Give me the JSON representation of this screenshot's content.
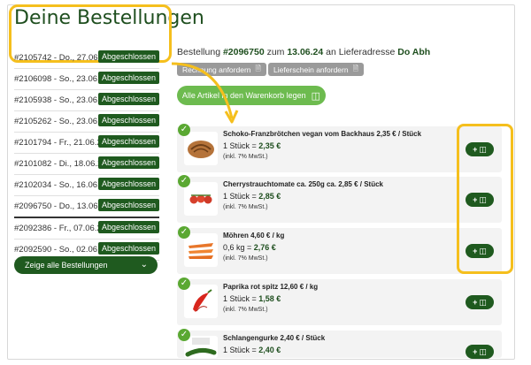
{
  "title": "Deine Bestellungen",
  "orders": [
    {
      "label": "#2105742 - Do., 27.06.24",
      "status": "Abgeschlossen"
    },
    {
      "label": "#2106098 - So., 23.06.24",
      "status": "Abgeschlossen"
    },
    {
      "label": "#2105938 - So., 23.06.24",
      "status": "Abgeschlossen"
    },
    {
      "label": "#2105262 - So., 23.06.24",
      "status": "Abgeschlossen"
    },
    {
      "label": "#2101794 - Fr., 21.06.24",
      "status": "Abgeschlossen"
    },
    {
      "label": "#2101082 - Di., 18.06.24",
      "status": "Abgeschlossen"
    },
    {
      "label": "#2102034 - So., 16.06.24",
      "status": "Abgeschlossen"
    },
    {
      "label": "#2096750 - Do., 13.06.24",
      "status": "Abgeschlossen"
    },
    {
      "label": "#2092386 - Fr., 07.06.24",
      "status": "Abgeschlossen"
    },
    {
      "label": "#2092590 - So., 02.06.24",
      "status": "Abgeschlossen"
    }
  ],
  "show_all": "Zeige alle Bestellungen",
  "detail": {
    "prefix": "Bestellung ",
    "order_no": "#2096750",
    "middle": " zum ",
    "date": "13.06.24",
    "suffix": " an Lieferadresse ",
    "address": "Do Abh",
    "invoice_btn": "Rechnung anfordern",
    "delivery_btn": "Lieferschein anfordern",
    "cart_all": "Alle Artikel in den Warenkorb legen"
  },
  "items": [
    {
      "name": "Schoko-Franzbrötchen vegan vom Backhaus 2,35 € / Stück",
      "qty": "1 Stück = ",
      "price": "2,35 €",
      "tax": "(inkl. 7% MwSt.)"
    },
    {
      "name": "Cherrystrauchtomate ca. 250g ca. 2,85 € / Stück",
      "qty": "1 Stück = ",
      "price": "2,85 €",
      "tax": "(inkl. 7% MwSt.)"
    },
    {
      "name": "Möhren 4,60 € / kg",
      "qty": "0,6 kg = ",
      "price": "2,76 €",
      "tax": "(inkl. 7% MwSt.)"
    },
    {
      "name": "Paprika rot spitz 12,60 € / kg",
      "qty": "1 Stück = ",
      "price": "1,58 €",
      "tax": "(inkl. 7% MwSt.)"
    },
    {
      "name": "Schlangengurke 2,40 € / Stück",
      "qty": "1 Stück = ",
      "price": "2,40 €",
      "tax": ""
    }
  ],
  "icons": {
    "check": "check-icon",
    "cart": "cart-box-icon",
    "document": "document-icon",
    "chevron": "chevron-down-icon"
  },
  "colors": {
    "brand_dark_green": "#1f5a1f",
    "accent_green": "#6dbb4f",
    "highlight": "#f5bf1d"
  }
}
